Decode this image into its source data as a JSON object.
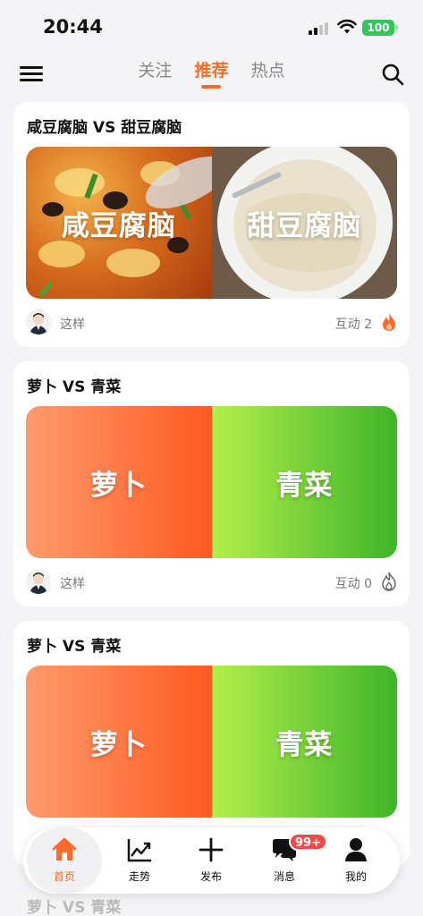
{
  "status": {
    "time": "20:44",
    "battery": "100"
  },
  "nav": {
    "tabs": [
      {
        "label": "关注",
        "active": false
      },
      {
        "label": "推荐",
        "active": true
      },
      {
        "label": "热点",
        "active": false
      }
    ]
  },
  "cards": [
    {
      "title": "咸豆腐脑 VS 甜豆腐脑",
      "left_label": "咸豆腐脑",
      "right_label": "甜豆腐脑",
      "author": "这样",
      "interact": "互动 2"
    },
    {
      "title": "萝卜 VS 青菜",
      "left_label": "萝卜",
      "right_label": "青菜",
      "author": "这样",
      "interact": "互动 0"
    },
    {
      "title": "萝卜 VS 青菜",
      "left_label": "萝卜",
      "right_label": "青菜"
    }
  ],
  "peek_title": "萝卜 VS 青菜",
  "tabbar": {
    "items": [
      {
        "label": "首页",
        "icon": "home-icon"
      },
      {
        "label": "走势",
        "icon": "trend-chart-icon"
      },
      {
        "label": "发布",
        "icon": "plus-icon"
      },
      {
        "label": "消息",
        "icon": "message-icon",
        "badge": "99+"
      },
      {
        "label": "我的",
        "icon": "user-icon"
      }
    ]
  },
  "colors": {
    "accent": "#ff6a2b",
    "orange_gradient": [
      "#ff9a6c",
      "#ff5a1f"
    ],
    "green_gradient": [
      "#b4ef4a",
      "#3eb52a"
    ],
    "badge": "#f44848"
  }
}
